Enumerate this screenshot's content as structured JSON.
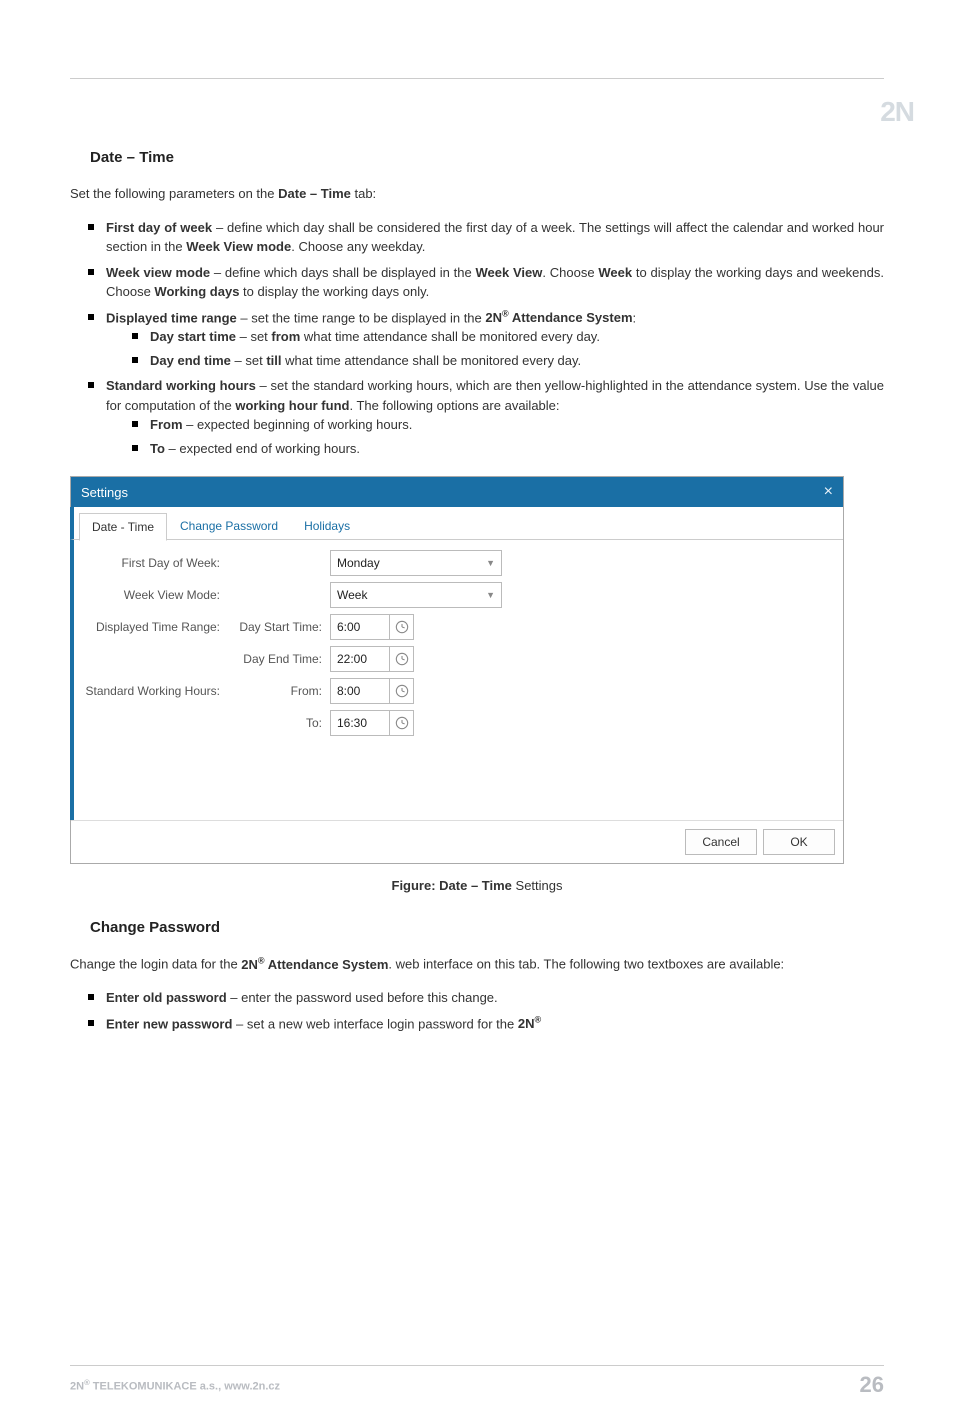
{
  "logo": "2N",
  "section1": {
    "title": "Date – Time",
    "intro_pre": "Set the following parameters on the ",
    "intro_bold": "Date – Time",
    "intro_post": " tab:",
    "b1": {
      "lead": "First day of week",
      "t1": " – define which day shall be considered the first day of a week. The settings will affect the calendar and worked hour section in the ",
      "bold2": "Week View mode",
      "t2": ". Choose any weekday."
    },
    "b2": {
      "lead": "Week view mode",
      "t1": " – define which days shall be displayed in the ",
      "bold2": "Week View",
      "t2": ". Choose ",
      "bold3": "Week",
      "t3": " to display the working days and weekends. Choose ",
      "bold4": "Working days",
      "t4": " to display the working days only."
    },
    "b3": {
      "lead": "Displayed time range",
      "t1": " – set the time range to be displayed in the ",
      "bold2": "2N",
      "sup2": "®",
      "bold3": " Attendance System",
      "t2": ":",
      "s1_lead": "Day start time",
      "s1_t1": " – set ",
      "s1_bold": "from",
      "s1_t2": " what time attendance shall be monitored every day.",
      "s2_lead": "Day end time",
      "s2_t1": " – set ",
      "s2_bold": "till",
      "s2_t2": " what time attendance shall be monitored every day."
    },
    "b4": {
      "lead": "Standard working hours",
      "t1": " – set the standard working hours, which are then yellow-highlighted in the attendance system. Use the value for computation of the ",
      "bold2": "working hour fund",
      "t2": ". The following options are available:",
      "s1_lead": "From",
      "s1_t": " – expected beginning of working hours.",
      "s2_lead": "To",
      "s2_t": " – expected end of working hours."
    }
  },
  "dialog": {
    "title": "Settings",
    "close": "×",
    "tabs": [
      "Date - Time",
      "Change Password",
      "Holidays"
    ],
    "rows": {
      "first_day_label": "First Day of Week:",
      "first_day_value": "Monday",
      "week_view_label": "Week View Mode:",
      "week_view_value": "Week",
      "dtr_label": "Displayed Time Range:",
      "day_start_label": "Day Start Time:",
      "day_start_value": "6:00",
      "day_end_label": "Day End Time:",
      "day_end_value": "22:00",
      "swh_label": "Standard Working Hours:",
      "from_label": "From:",
      "from_value": "8:00",
      "to_label": "To:",
      "to_value": "16:30"
    },
    "buttons": {
      "cancel": "Cancel",
      "ok": "OK"
    }
  },
  "caption_pre": "Figure: Date – Time",
  "caption_post": " Settings",
  "section2": {
    "title": "Change Password",
    "intro_pre": "Change the login data for the ",
    "intro_bold1": "2N",
    "intro_sup": "®",
    "intro_bold2": " Attendance System",
    "intro_post": ". web interface on this tab. The following two textboxes are available:",
    "b1_lead": "Enter old password",
    "b1_t": " – enter the password used before this change.",
    "b2_lead": "Enter new password",
    "b2_t1": " – set a new web interface login password for the ",
    "b2_bold": "2N",
    "b2_sup": "®"
  },
  "footer": {
    "left_pre": "2N",
    "left_sup": "®",
    "left_post": " TELEKOMUNIKACE a.s., www.2n.cz",
    "page": "26"
  }
}
